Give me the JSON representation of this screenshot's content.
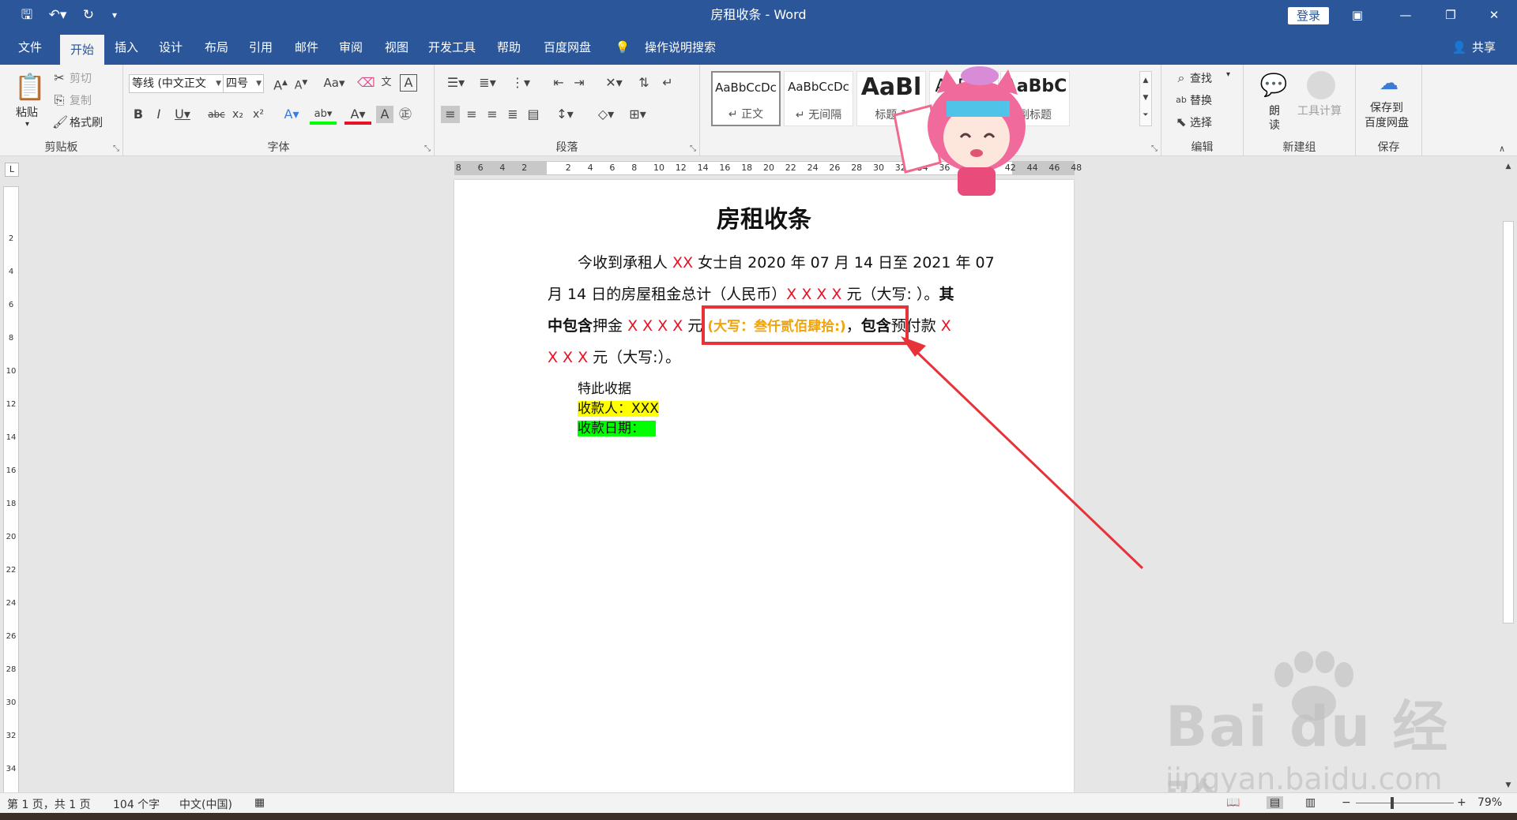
{
  "window": {
    "title": "房租收条  -  Word",
    "login_label": "登录",
    "share_label": "共享"
  },
  "tabs": [
    "文件",
    "开始",
    "插入",
    "设计",
    "布局",
    "引用",
    "邮件",
    "审阅",
    "视图",
    "开发工具",
    "帮助",
    "百度网盘"
  ],
  "tell_me": "操作说明搜索",
  "ribbon": {
    "clipboard": {
      "label": "剪贴板",
      "paste": "粘贴",
      "cut": "剪切",
      "copy": "复制",
      "format_painter": "格式刷"
    },
    "font": {
      "label": "字体",
      "font_name": "等线 (中文正文",
      "font_size": "四号"
    },
    "paragraph": {
      "label": "段落"
    },
    "styles": {
      "items": [
        {
          "sample": "AaBbCcDc",
          "name": "↵ 正文"
        },
        {
          "sample": "AaBbCcDc",
          "name": "↵ 无间隔"
        },
        {
          "sample": "AaBl",
          "name": "标题 1"
        },
        {
          "sample": "AaBbC",
          "name": "标题"
        },
        {
          "sample": "AaBbC",
          "name": "副标题"
        }
      ]
    },
    "editing": {
      "label": "编辑",
      "find": "查找",
      "replace": "替换",
      "select": "选择"
    },
    "newgroup": {
      "label": "新建组",
      "read": "朗读",
      "tools": "工具计算"
    },
    "save": {
      "label": "保存",
      "save_to": "保存到",
      "baidu": "百度网盘"
    }
  },
  "ruler": {
    "left_numbers": [
      "8",
      "6",
      "4",
      "2"
    ],
    "right_numbers": [
      "2",
      "4",
      "6",
      "8",
      "10",
      "12",
      "14",
      "16",
      "18",
      "20",
      "22",
      "24",
      "26",
      "28",
      "30",
      "32",
      "34",
      "36",
      "38",
      "40",
      "42",
      "44",
      "46",
      "48"
    ],
    "vertical_numbers": [
      "2",
      "4",
      "6",
      "8",
      "10",
      "12",
      "14",
      "16",
      "18",
      "20",
      "22",
      "24",
      "26",
      "28",
      "30",
      "32",
      "34",
      "36"
    ]
  },
  "document": {
    "title": "房租收条",
    "l1_a": "今收到承租人 ",
    "l1_red": "XX",
    "l1_b": " 女士自 2020 年 07 月 14 日至 2021 年 07",
    "l2_a": "月 14 日的房屋租金总计（人民币）",
    "l2_red": "X X X X",
    "l2_b": " 元（大写:    ）。",
    "l2_bold": "其",
    "l3_bold1": "中包含",
    "l3_a": "押金 ",
    "l3_red": "X X X X",
    "l3_b": " 元 ",
    "l3_orange": "(大写：叁仟贰佰肆拾:)",
    "l3_c": "，",
    "l3_bold2": "包含",
    "l3_d": "预付款 ",
    "l3_red2": "X",
    "l4_red": "X X X",
    "l4_a": " 元（大写:）。",
    "receipt": "特此收据",
    "payee": "收款人：XXX",
    "date": "收款日期："
  },
  "status": {
    "page": "第 1 页，共 1 页",
    "words": "104 个字",
    "lang": "中文(中国)",
    "zoom": "79%"
  },
  "watermark": {
    "brand": "Bai du 经验",
    "url": "jingyan.baidu.com"
  },
  "colors": {
    "accent": "#2b579a",
    "annotation": "#e8323a",
    "red_text": "#e81123",
    "orange_text": "#f0a30a",
    "highlight_yellow": "#ffff00",
    "highlight_green": "#00ff00"
  }
}
